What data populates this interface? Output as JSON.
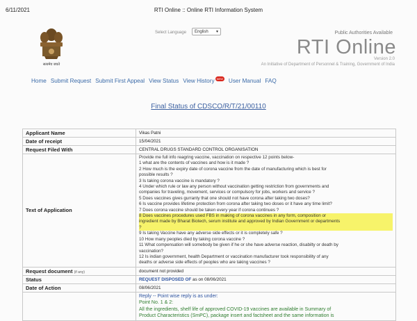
{
  "browser": {
    "date": "6/11/2021",
    "page_title": "RTI Online :: Online RTI Information System"
  },
  "header": {
    "language_label": "Select Language",
    "language_value": "English",
    "public_authorities_link": "Public Authorities Available",
    "brand": "RTI Online",
    "version": "Version 2.0",
    "tagline": "An Initiative of Department of Personnel & Training, Government of India",
    "emblem_caption": "सत्यमेव जयते"
  },
  "nav": {
    "items": [
      "Home",
      "Submit Request",
      "Submit First Appeal",
      "View Status",
      "View History",
      "User Manual",
      "FAQ"
    ],
    "new_badge": "NEW"
  },
  "status_title": "Final Status of  CDSCO/R/T/21/00110",
  "details": {
    "applicant_name_label": "Applicant Name",
    "applicant_name": "Vikas Patni",
    "date_of_receipt_label": "Date of receipt",
    "date_of_receipt": "15/04/2021",
    "request_filed_with_label": "Request Filed With",
    "request_filed_with": "CENTRAL DRUGS STANDARD CONTROL ORGANISATION",
    "text_of_application_label": "Text of Application",
    "application_lines": [
      "Provide me full info reagring vaccine, vaccination on respective 12 points below-",
      "1 what are the contents of vaccines and how is it made ?",
      "2 How much is the expiry date of corona vaccine from the date of manufacturing which is best for",
      "possible results ?",
      "3 Is taking corona vaccine is mandatory ?",
      "4 Under which rule or law any person without vaccination getting restriction from governments and",
      "companies for traveling, movement, services or compulsory for jobs, workers and service ?",
      "5 Does vaccines gives gurranty that one should not have corona after taking two doses?",
      "6 Is vaccine provides lifetime protection from corona after taking two doses or it have any time limit?",
      "7 Does corona vaccine should be taken every year if corona continues ?"
    ],
    "highlighted_lines": [
      "8 Does vaccines procedures used FBS in making of corona vaccines in any form, composition or",
      "ingredient made by Bharat Biotech, serum institute and approved by Indian Government or departments",
      "?"
    ],
    "application_lines_after": [
      "9 Is taking Vaccine have any adverse side effects or it is completely safe ?",
      "10 How many peoples died by taking corona vaccine ?",
      "11 What compensation will somebody be given if he or she have adverse reaction, disabilty or death by",
      "vaccination?",
      "12 Is indian government, health Department or vaccination manufacturer took responsibility of any",
      "deaths or adverse side effects of peoples who are taking vaccines ?"
    ],
    "request_document_label": "Request document",
    "request_document_note": "(if any)",
    "request_document": "document not provided",
    "status_label": "Status",
    "status_value": "REQUEST DISPOSED OF",
    "status_suffix": "as on 08/06/2021",
    "date_of_action_label": "Date of Action",
    "date_of_action": "08/06/2021",
    "reply_label": "Reply",
    "reply_text": "-- Point wise reply is as under:",
    "reply_lines": [
      "Point No. 1 & 2:",
      "All the ingredients, shelf life of approved COVID-19 vaccines are available in Summary of",
      "Product Characteristics (SmPC), package insert and factsheet and the same information is"
    ]
  }
}
